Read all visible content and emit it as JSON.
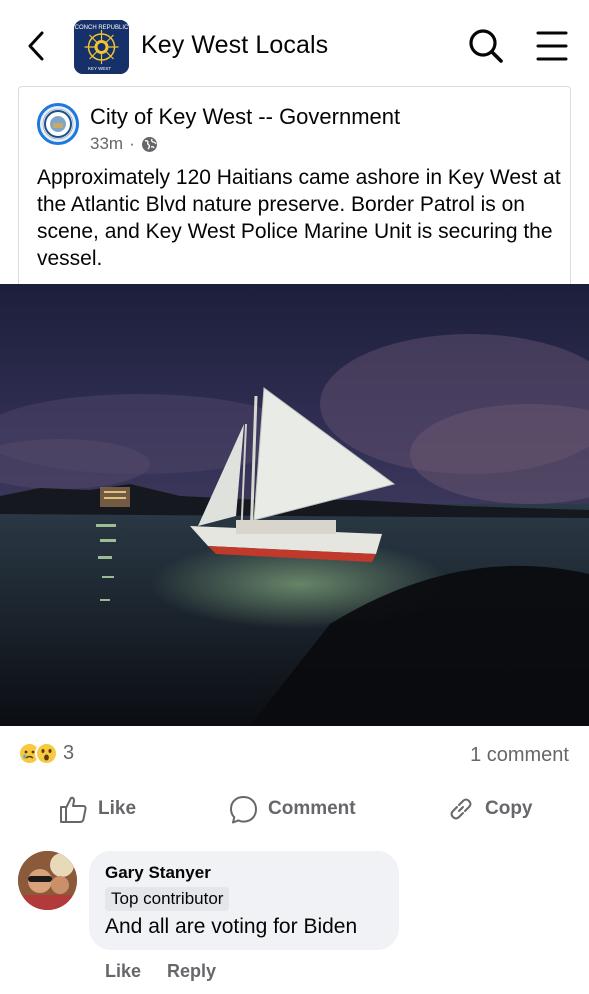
{
  "header": {
    "group_title": "Key West Locals",
    "logo_text_top": "CONCH REPUBLIC",
    "logo_text_bottom": "KEY WEST",
    "icons": [
      "back-chevron-icon",
      "search-icon",
      "hamburger-menu-icon"
    ]
  },
  "post": {
    "page_name": "City of Key West -- Government",
    "time": "33m",
    "separator": "·",
    "audience_icon": "globe-icon",
    "text": "Approximately 120 Haitians came ashore in Key West at the Atlantic Blvd nature preserve. Border Patrol is on scene, and Key West Police Marine Unit is securing the vessel."
  },
  "reactions": {
    "icons": [
      "sad-emoji-icon",
      "wow-emoji-icon"
    ],
    "count": "3",
    "comment_count": "1 comment"
  },
  "actions": {
    "like": "Like",
    "comment": "Comment",
    "copy": "Copy"
  },
  "comment": {
    "name": "Gary Stanyer",
    "badge": "Top contributor",
    "text": "And all are voting for Biden",
    "like": "Like",
    "reply": "Reply"
  },
  "colors": {
    "accent_blue": "#1d78e0",
    "secondary_text": "#65676b",
    "bubble_bg": "#f0f2f5",
    "reaction_yellow": "#f7c940"
  }
}
